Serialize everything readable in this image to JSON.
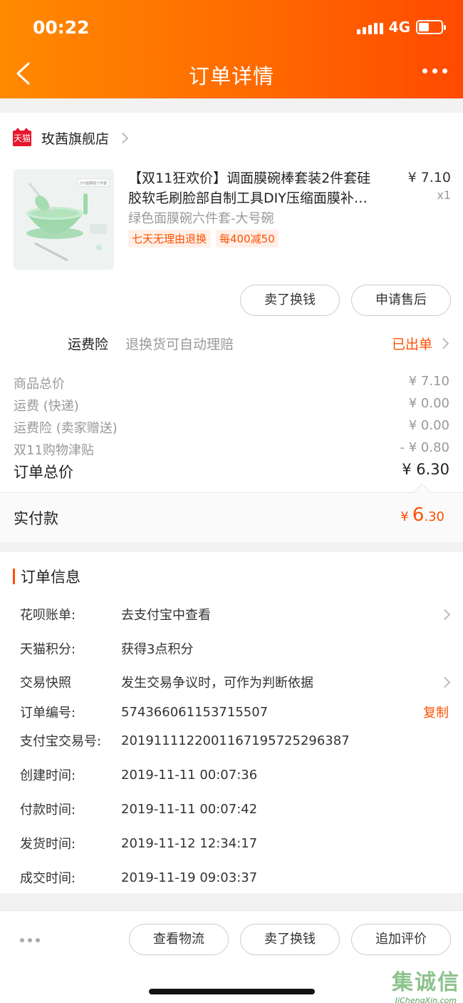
{
  "status_bar": {
    "time": "00:22",
    "network": "4G"
  },
  "nav": {
    "title": "订单详情"
  },
  "shop": {
    "logo_text": "天猫",
    "name": "玫茜旗舰店"
  },
  "product": {
    "title_line1": "【双11狂欢价】调面膜碗棒套装2件套硅",
    "title_line2": "胶软毛刷脸部自制工具DIY压缩面膜补…",
    "price": "¥ 7.10",
    "qty": "x1",
    "sku": "绿色面膜碗六件套-大号碗",
    "tags": [
      "七天无理由退换",
      "每400减50"
    ],
    "image_label": "DIY面膜碗六件套"
  },
  "product_actions": {
    "sell": "卖了换钱",
    "after_sale": "申请售后"
  },
  "insurance": {
    "label": "运费险",
    "desc": "退换货可自动理赔",
    "status": "已出单"
  },
  "fees": [
    {
      "label": "商品总价",
      "value": "¥ 7.10"
    },
    {
      "label": "运费 (快递)",
      "value": "¥ 0.00"
    },
    {
      "label": "运费险 (卖家赠送)",
      "value": "¥ 0.00"
    },
    {
      "label": "双11购物津贴",
      "value": "- ¥ 0.80"
    }
  ],
  "total": {
    "label": "订单总价",
    "value": "¥ 6.30"
  },
  "paid": {
    "label": "实付款",
    "yen": "¥",
    "int": "6",
    "dec": ".30"
  },
  "order_info": {
    "title": "订单信息",
    "rows": [
      {
        "key": "花呗账单:",
        "value": "去支付宝中查看"
      },
      {
        "key": "天猫积分:",
        "value": "获得3点积分"
      },
      {
        "key": "交易快照",
        "value": "发生交易争议时，可作为判断依据"
      },
      {
        "key": "订单编号:",
        "value": "574366061153715507",
        "action": "复制"
      },
      {
        "key": "支付宝交易号:",
        "value": "2019111122001167195725296387"
      },
      {
        "key": "创建时间:",
        "value": "2019-11-11 00:07:36"
      },
      {
        "key": "付款时间:",
        "value": "2019-11-11 00:07:42"
      },
      {
        "key": "发货时间:",
        "value": "2019-11-12 12:34:17"
      },
      {
        "key": "成交时间:",
        "value": "2019-11-19 09:03:37"
      }
    ]
  },
  "bottom_bar": {
    "logistics": "查看物流",
    "sell": "卖了换钱",
    "review": "追加评价"
  },
  "watermark": {
    "main": "集诚信",
    "sub": "JiChengXin.com"
  },
  "colors": {
    "accent": "#ff5000",
    "header": "#ff6a00"
  },
  "icons": [
    "back-icon",
    "more-icon",
    "tmall-icon",
    "chevron-right-icon"
  ]
}
